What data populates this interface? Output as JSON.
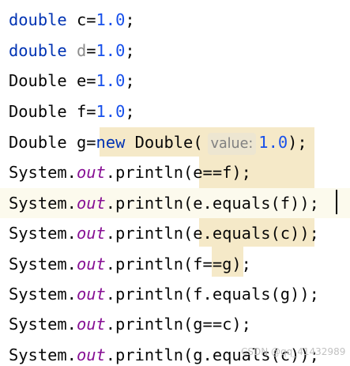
{
  "editor": {
    "lines": [
      {
        "type": "double",
        "name": "c",
        "op": "=",
        "value": "1.0",
        "end": ";"
      },
      {
        "type": "double",
        "name": "d",
        "op": "=",
        "value": "1.0",
        "end": ";"
      },
      {
        "type": "Double",
        "name": "e",
        "op": "=",
        "value": "1.0",
        "end": ";"
      },
      {
        "type": "Double",
        "name": "f",
        "op": "=",
        "value": "1.0",
        "end": ";"
      },
      {
        "type": "Double",
        "name": "g",
        "op": "=",
        "kw_new": "new",
        "ctor": "Double",
        "paren_open": "(",
        "hint": "value:",
        "value": "1.0",
        "end": ");"
      },
      {
        "prefix": "System.",
        "field": "out",
        "call": ".println(",
        "arg": "e==f",
        "end": ");"
      },
      {
        "prefix": "System.",
        "field": "out",
        "call": ".println(",
        "arg": "e.equals(f)",
        "end": ");"
      },
      {
        "prefix": "System.",
        "field": "out",
        "call": ".println(",
        "arg": "e.equals(c)",
        "end": ");"
      },
      {
        "prefix": "System.",
        "field": "out",
        "call": ".println(",
        "arg": "f==g",
        "end": ");"
      },
      {
        "prefix": "System.",
        "field": "out",
        "call": ".println(",
        "arg": "f.equals(g)",
        "end": ");"
      },
      {
        "prefix": "System.",
        "field": "out",
        "call": ".println(",
        "arg": "g==c",
        "end": ");"
      },
      {
        "prefix": "System.",
        "field": "out",
        "call": ".println(",
        "arg": "g.equals(c)",
        "end": ");"
      }
    ]
  },
  "watermark": "CSDN @qq_41432989",
  "colors": {
    "keyword": "#0033b3",
    "number": "#1750eb",
    "static_field": "#871094",
    "unused_variable": "#8c8c8c",
    "text": "#080808",
    "usage_highlight": "#f5e9c8",
    "current_line": "#fcfaed",
    "hint_background": "#ede6d1",
    "hint_text": "#808080"
  }
}
